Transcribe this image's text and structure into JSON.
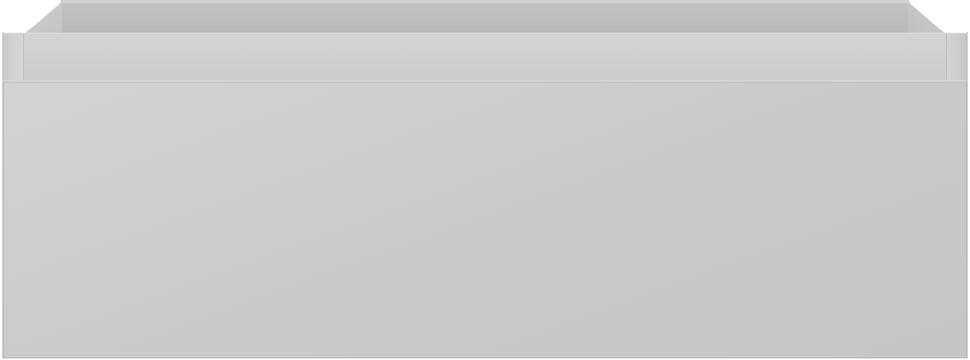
{
  "object": {
    "kind": "open rectangular box / drawer",
    "colors": {
      "body": "#cbcbcb",
      "rail": "#d2d2d2",
      "interior": "#bdbdbd",
      "edge": "#b8b8b8"
    }
  }
}
